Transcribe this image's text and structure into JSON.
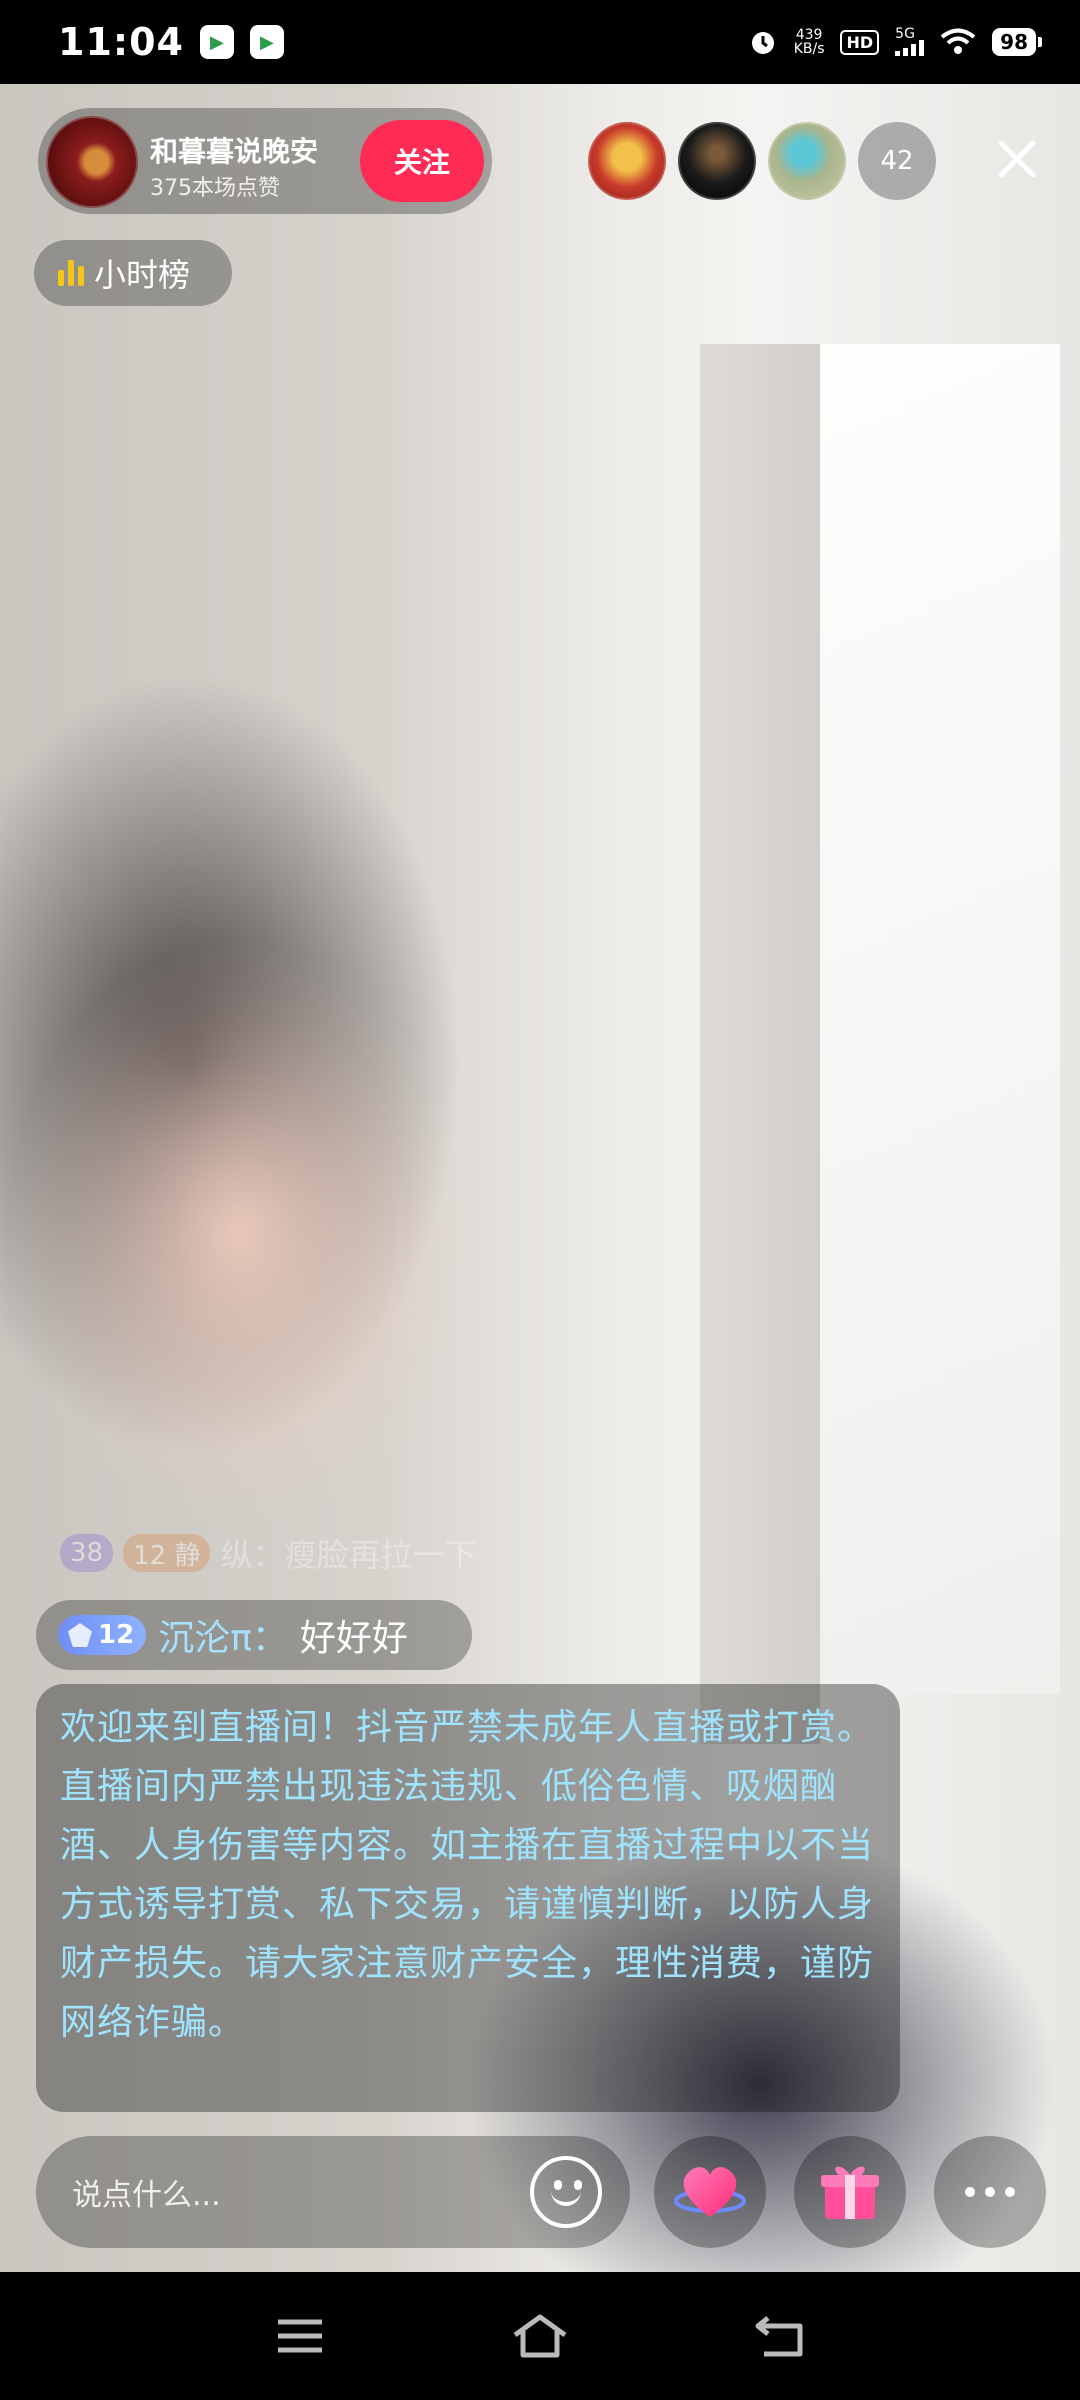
{
  "status_bar": {
    "time": "11:04",
    "net_speed_value": "439",
    "net_speed_unit": "KB/s",
    "hd": "HD",
    "network": "5G",
    "battery": "98"
  },
  "anchor": {
    "name": "和暮暮说晚安",
    "likes": "375本场点赞",
    "follow_label": "关注"
  },
  "viewers": {
    "count": "42"
  },
  "ranking": {
    "label": "小时榜"
  },
  "faded_comment": {
    "badge1": "38",
    "badge2": "12 静",
    "text": "纵：瘦脸再拉一下"
  },
  "chat_comment": {
    "level": "12",
    "user": "沉沦π：",
    "text": "好好好"
  },
  "notice": {
    "text": "欢迎来到直播间！抖音严禁未成年人直播或打赏。直播间内严禁出现违法违规、低俗色情、吸烟酗酒、人身伤害等内容。如主播在直播过程中以不当方式诱导打赏、私下交易，请谨慎判断，以防人身财产损失。请大家注意财产安全，理性消费，谨防网络诈骗。"
  },
  "input": {
    "placeholder": "说点什么..."
  },
  "icons": {
    "close": "close-icon",
    "emoji": "emoji-icon",
    "heart": "heart-icon",
    "gift": "gift-icon",
    "more": "more-icon"
  },
  "colors": {
    "follow": "#fe2c55",
    "notice_text": "#9fe4ff",
    "username": "#a5e2ff",
    "ranking_bars": "#f5c518"
  }
}
